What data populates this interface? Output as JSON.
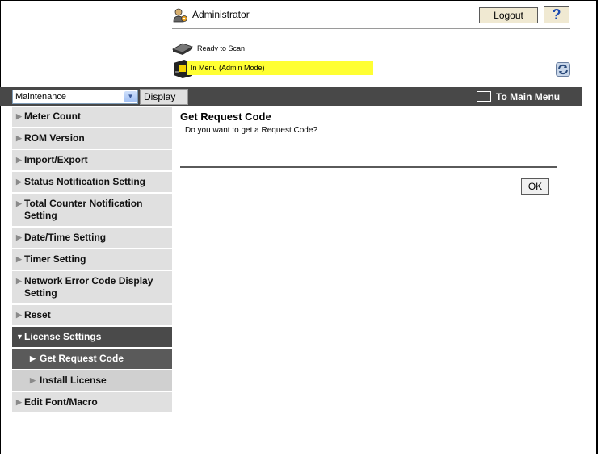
{
  "header": {
    "user_label": "Administrator",
    "logout_label": "Logout",
    "help_label": "?",
    "ready_status": "Ready to Scan",
    "menu_status": "In Menu (Admin Mode)"
  },
  "toolbar": {
    "mode_selected": "Maintenance",
    "display_label": "Display",
    "main_menu_label": "To Main Menu"
  },
  "sidebar": {
    "items": [
      {
        "label": "Meter Count"
      },
      {
        "label": "ROM Version"
      },
      {
        "label": "Import/Export"
      },
      {
        "label": "Status Notification Setting"
      },
      {
        "label": "Total Counter Notification Setting"
      },
      {
        "label": "Date/Time Setting"
      },
      {
        "label": "Timer Setting"
      },
      {
        "label": "Network Error Code Display Setting"
      },
      {
        "label": "Reset"
      },
      {
        "label": "License Settings"
      },
      {
        "label": "Get Request Code"
      },
      {
        "label": "Install License"
      },
      {
        "label": "Edit Font/Macro"
      }
    ]
  },
  "main": {
    "title": "Get Request Code",
    "message": "Do you want to get a Request Code?",
    "ok_label": "OK"
  },
  "colors": {
    "toolbar_bg": "#484848",
    "status_highlight": "#ffff33",
    "sidebar_bg": "#e0e0e0",
    "active_bg": "#4a4a4a"
  }
}
